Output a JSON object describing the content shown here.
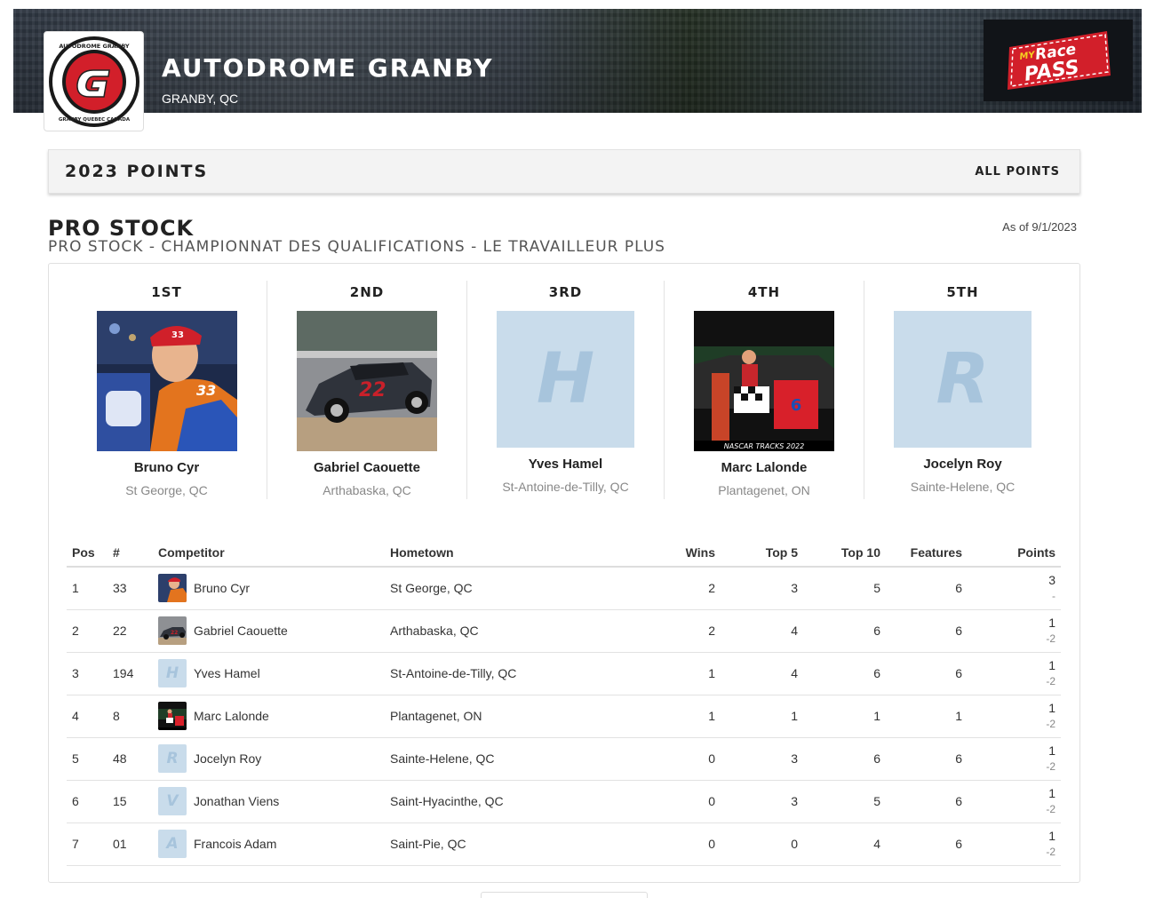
{
  "header": {
    "track_name": "AUTODROME GRANBY",
    "location": "GRANBY, QC",
    "logo_ring_text_top": "AUTODROME GRANBY",
    "logo_ring_text_bottom": "GRANBY QUEBEC CANADA",
    "partner_logo": "MyRacePass"
  },
  "points_bar": {
    "title": "2023 POINTS",
    "all_points_link": "ALL POINTS"
  },
  "class": {
    "title": "PRO STOCK",
    "subtitle": "PRO STOCK - CHAMPIONNAT DES QUALIFICATIONS - LE TRAVAILLEUR PLUS",
    "as_of": "As of 9/1/2023"
  },
  "podium": [
    {
      "place": "1ST",
      "name": "Bruno Cyr",
      "hometown": "St George, QC",
      "photo": "driver-photo"
    },
    {
      "place": "2ND",
      "name": "Gabriel Caouette",
      "hometown": "Arthabaska, QC",
      "photo": "car-photo"
    },
    {
      "place": "3RD",
      "name": "Yves Hamel",
      "hometown": "St-Antoine-de-Tilly, QC",
      "placeholder_letter": "H"
    },
    {
      "place": "4TH",
      "name": "Marc Lalonde",
      "hometown": "Plantagenet, ON",
      "photo": "victory-lane-photo"
    },
    {
      "place": "5TH",
      "name": "Jocelyn Roy",
      "hometown": "Sainte-Helene, QC",
      "placeholder_letter": "R"
    }
  ],
  "table": {
    "columns": [
      "Pos",
      "#",
      "Competitor",
      "Hometown",
      "Wins",
      "Top 5",
      "Top 10",
      "Features",
      "Points"
    ],
    "rows": [
      {
        "pos": "1",
        "num": "33",
        "name": "Bruno Cyr",
        "hometown": "St George, QC",
        "wins": "2",
        "top5": "3",
        "top10": "5",
        "features": "6",
        "points": "3",
        "diff": "-"
      },
      {
        "pos": "2",
        "num": "22",
        "name": "Gabriel Caouette",
        "hometown": "Arthabaska, QC",
        "wins": "2",
        "top5": "4",
        "top10": "6",
        "features": "6",
        "points": "1",
        "diff": "-2"
      },
      {
        "pos": "3",
        "num": "194",
        "name": "Yves Hamel",
        "hometown": "St-Antoine-de-Tilly, QC",
        "wins": "1",
        "top5": "4",
        "top10": "6",
        "features": "6",
        "points": "1",
        "diff": "-2",
        "letter": "H"
      },
      {
        "pos": "4",
        "num": "8",
        "name": "Marc Lalonde",
        "hometown": "Plantagenet, ON",
        "wins": "1",
        "top5": "1",
        "top10": "1",
        "features": "1",
        "points": "1",
        "diff": "-2"
      },
      {
        "pos": "5",
        "num": "48",
        "name": "Jocelyn Roy",
        "hometown": "Sainte-Helene, QC",
        "wins": "0",
        "top5": "3",
        "top10": "6",
        "features": "6",
        "points": "1",
        "diff": "-2",
        "letter": "R"
      },
      {
        "pos": "6",
        "num": "15",
        "name": "Jonathan Viens",
        "hometown": "Saint-Hyacinthe, QC",
        "wins": "0",
        "top5": "3",
        "top10": "5",
        "features": "6",
        "points": "1",
        "diff": "-2",
        "letter": "V"
      },
      {
        "pos": "7",
        "num": "01",
        "name": "Francois Adam",
        "hometown": "Saint-Pie, QC",
        "wins": "0",
        "top5": "0",
        "top10": "4",
        "features": "6",
        "points": "1",
        "diff": "-2",
        "letter": "A"
      }
    ]
  },
  "colors": {
    "placeholder_bg": "#c9dceb",
    "placeholder_fg": "#a7c4dc",
    "logo_red": "#d21f2a",
    "partner_bg": "#111418"
  }
}
